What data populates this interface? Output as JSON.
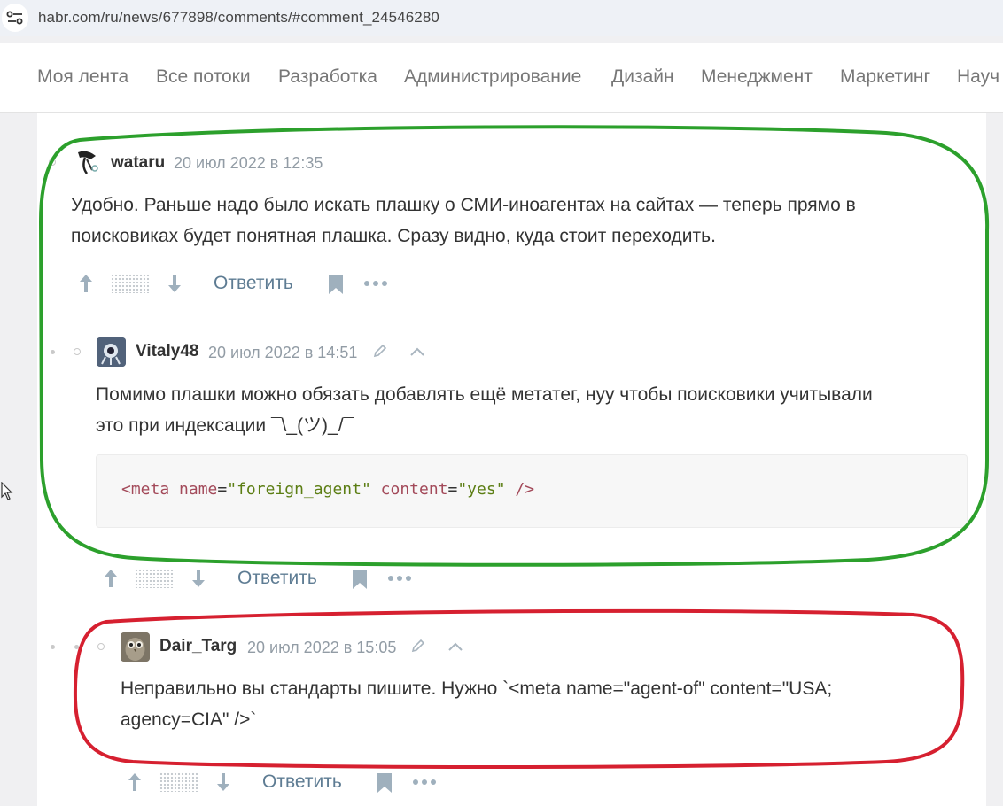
{
  "browser": {
    "url": "habr.com/ru/news/677898/comments/#comment_24546280"
  },
  "nav": {
    "items": [
      "Моя лента",
      "Все потоки",
      "Разработка",
      "Администрирование",
      "Дизайн",
      "Менеджмент",
      "Маркетинг",
      "Науч"
    ]
  },
  "comments": [
    {
      "username": "wataru",
      "datetime": "20 июл 2022 в 12:35",
      "text_lines": [
        "Удобно. Раньше надо было искать плашку о СМИ-иноагентах на сайтах — теперь прямо в",
        "поисковиках будет понятная плашка. Сразу видно, куда стоит переходить."
      ],
      "reply_label": "Ответить",
      "avatar_icon": "bird-avatar"
    },
    {
      "username": "Vitaly48",
      "datetime": "20 июл 2022 в 14:51",
      "text_lines": [
        "Помимо плашки можно обязать добавлять ещё метатег, нуу чтобы поисковики учитывали",
        "это при индексации ¯\\_(ツ)_/¯"
      ],
      "code": {
        "tag_open": "<meta",
        "attr1": "name",
        "eq1": "=",
        "val1": "\"foreign_agent\"",
        "attr2": "content",
        "eq2": "=",
        "val2": "\"yes\"",
        "tag_close": "/>"
      },
      "reply_label": "Ответить",
      "avatar_icon": "robot-avatar"
    },
    {
      "username": "Dair_Targ",
      "datetime": "20 июл 2022 в 15:05",
      "text_lines": [
        "Неправильно вы стандарты пишите. Нужно `<meta name=\"agent-of\" content=\"USA;",
        "agency=CIA\" />`"
      ],
      "reply_label": "Ответить",
      "avatar_icon": "owl-avatar"
    }
  ],
  "colors": {
    "green_annotation": "#2ca02c",
    "red_annotation": "#d62030",
    "link": "#5e7c93"
  }
}
